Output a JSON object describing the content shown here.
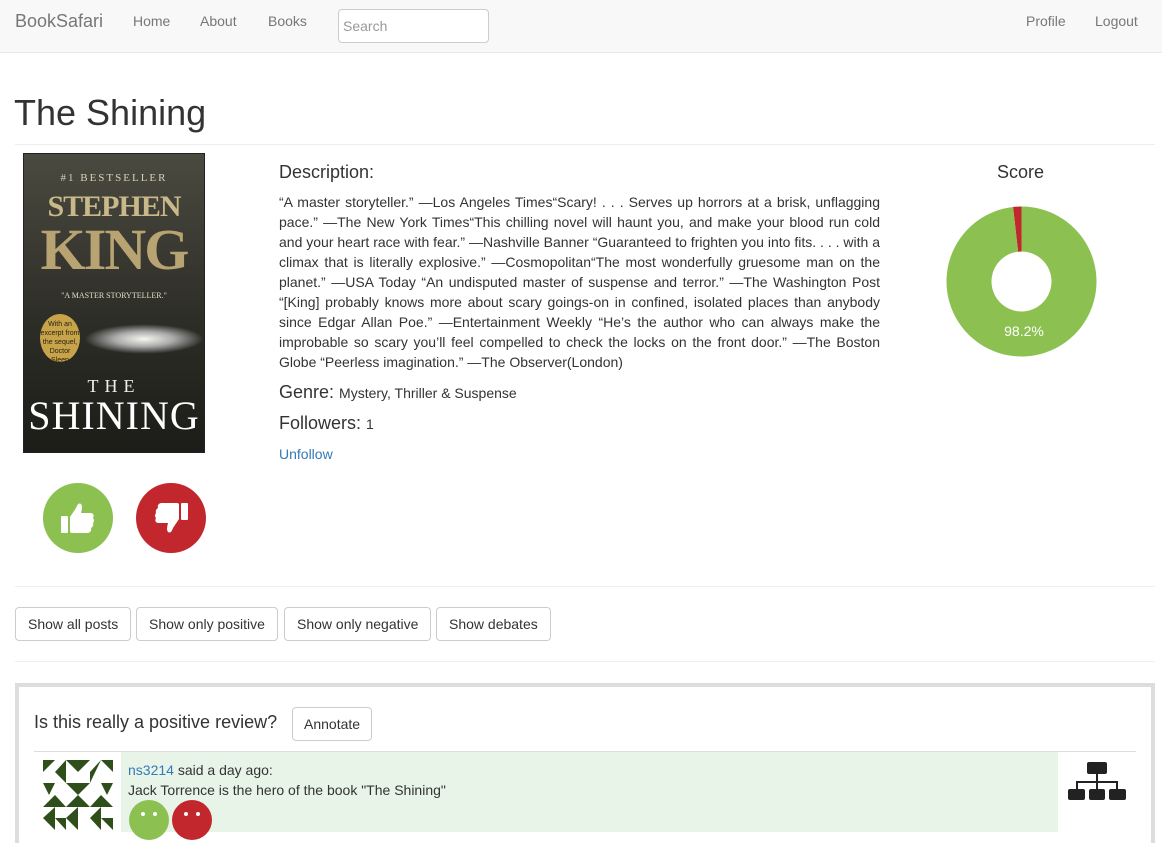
{
  "navbar": {
    "brand": "BookSafari",
    "links": [
      "Home",
      "About",
      "Books"
    ],
    "search_placeholder": "Search",
    "right_links": [
      "Profile",
      "Logout"
    ]
  },
  "book": {
    "title": "The Shining",
    "cover": {
      "tag": "#1 BESTSELLER",
      "author_first": "STEPHEN",
      "author_last": "KING",
      "blurb": "\"A MASTER STORYTELLER.\"",
      "seal": "With an excerpt from the sequel, Doctor Sleep",
      "title_top": "THE",
      "title_bottom": "SHINING"
    },
    "description_label": "Description:",
    "description": "“A master storyteller.” —Los Angeles Times“Scary! . . . Serves up horrors at a brisk, unflagging pace.” —The New York Times“This chilling novel will haunt you, and make your blood run cold and your heart race with fear.” —Nashville Banner “Guaranteed to frighten you into fits. . . . with a climax that is literally explosive.” —Cosmopolitan“The most wonderfully gruesome man on the planet.” —USA Today “An undisputed master of suspense and terror.” —The Washington Post “[King] probably knows more about scary goings-on in confined, isolated places than anybody since Edgar Allan Poe.” —Entertainment Weekly “He’s the author who can always make the improbable so scary you’ll feel compelled to check the locks on the front door.” —The Boston Globe “Peerless imagination.” —The Observer(London)",
    "genre_label": "Genre:",
    "genre": "Mystery, Thriller & Suspense",
    "followers_label": "Followers:",
    "followers": "1",
    "unfollow_label": "Unfollow"
  },
  "score": {
    "title": "Score",
    "positive_fraction": 0.982,
    "label": "98.2%",
    "positive_color": "#8cc152",
    "negative_color": "#c1272d"
  },
  "filters": [
    "Show all posts",
    "Show only positive",
    "Show only negative",
    "Show debates"
  ],
  "post": {
    "question": "Is this really a positive review?",
    "annotate_label": "Annotate",
    "username": "ns3214",
    "said": " said a day ago:",
    "text": "Jack Torrence is the hero of the book \"The Shining\""
  }
}
